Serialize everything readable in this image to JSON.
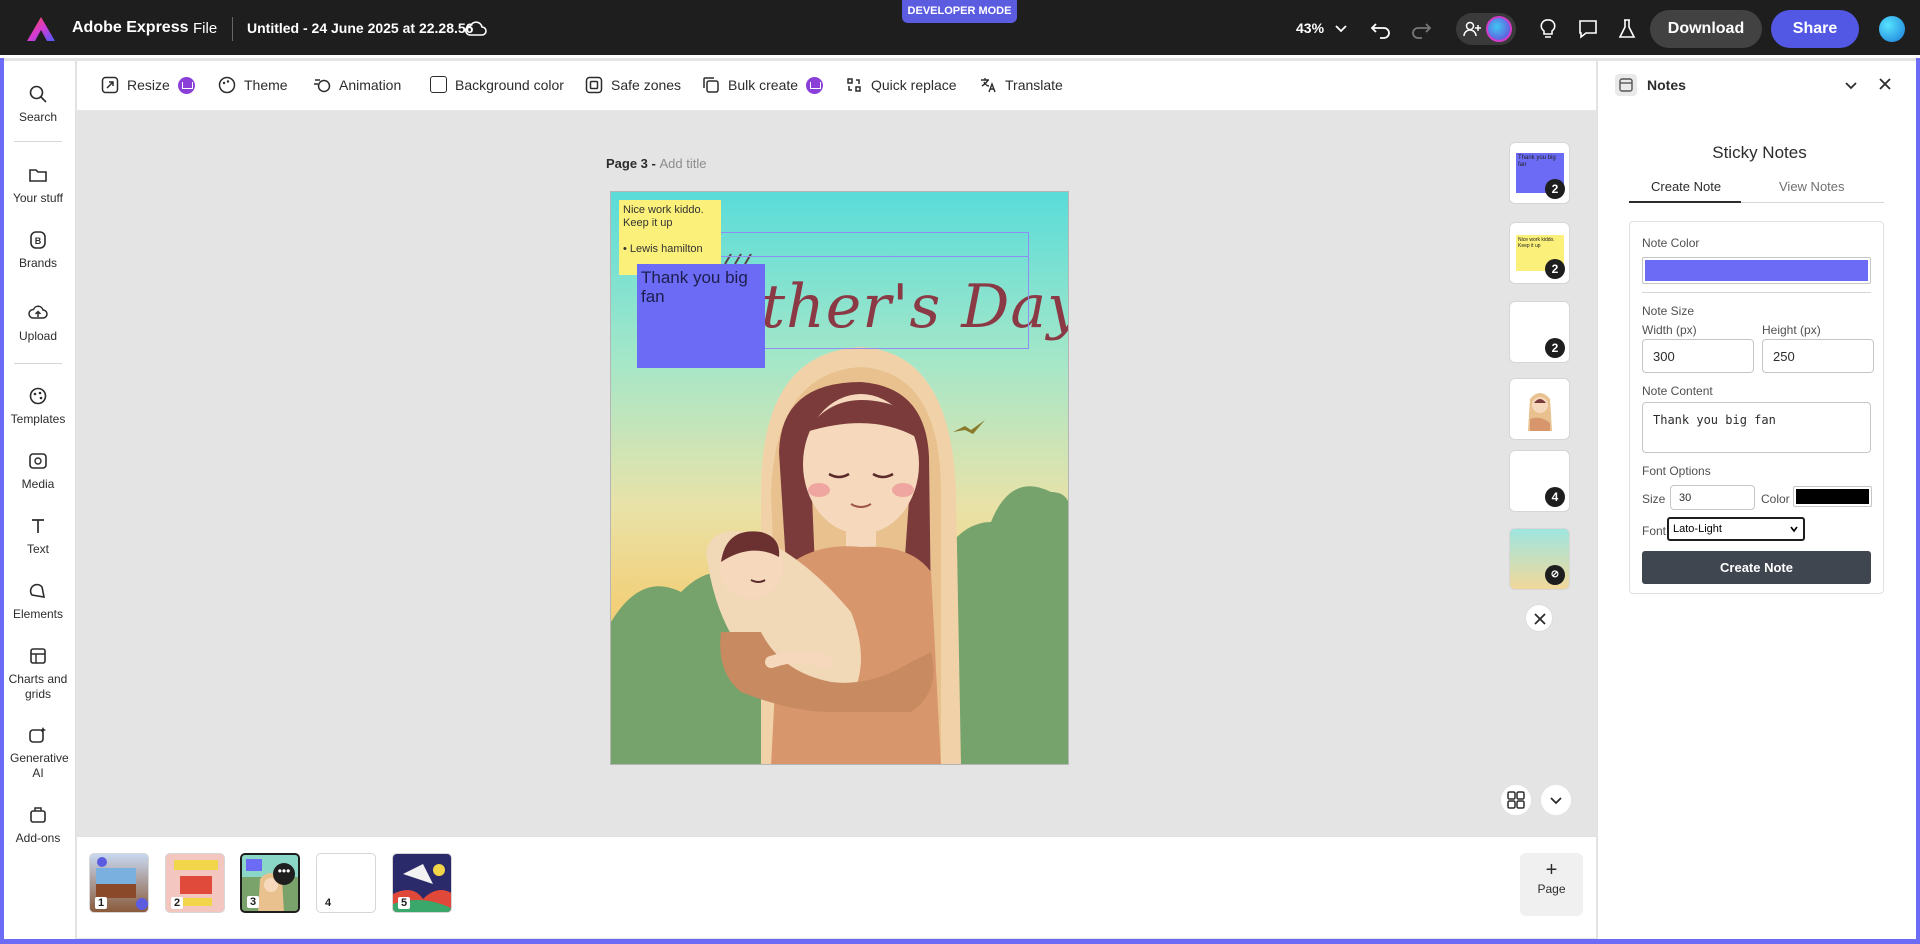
{
  "topbar": {
    "app_name": "Adobe Express",
    "file_menu": "File",
    "document_title": "Untitled - 24 June 2025 at 22.28.56",
    "dev_mode": "DEVELOPER MODE",
    "zoom": "43%",
    "download": "Download",
    "share": "Share"
  },
  "left_rail": {
    "items": [
      {
        "label": "Search",
        "icon": "search-icon"
      },
      {
        "label": "Your stuff",
        "icon": "folder-icon"
      },
      {
        "label": "Brands",
        "icon": "brand-icon"
      },
      {
        "label": "Upload",
        "icon": "upload-icon"
      },
      {
        "label": "Templates",
        "icon": "templates-icon"
      },
      {
        "label": "Media",
        "icon": "media-icon"
      },
      {
        "label": "Text",
        "icon": "text-icon"
      },
      {
        "label": "Elements",
        "icon": "elements-icon"
      },
      {
        "label": "Charts and grids",
        "icon": "charts-icon"
      },
      {
        "label": "Generative AI",
        "icon": "generative-ai-icon"
      },
      {
        "label": "Add-ons",
        "icon": "addons-icon"
      }
    ]
  },
  "toolbar": {
    "resize": "Resize",
    "theme": "Theme",
    "animation": "Animation",
    "background_color": "Background color",
    "safe_zones": "Safe zones",
    "bulk_create": "Bulk create",
    "quick_replace": "Quick replace",
    "translate": "Translate"
  },
  "canvas": {
    "page_label": "Page 3 - ",
    "add_title": "Add title",
    "artwork_title": "ther's Day",
    "yellow_note_line1": "Nice work kiddo.",
    "yellow_note_line2": "Keep it up",
    "yellow_note_line3": "• Lewis hamilton",
    "blue_note": "Thank you big fan"
  },
  "side_thumbs": {
    "badges": [
      "2",
      "2",
      "2",
      "",
      "4",
      ""
    ],
    "thumb1_text": "Thank you big fan",
    "thumb2_text": "Nice work kiddo. Keep it up"
  },
  "bottom_strip": {
    "pages": [
      "1",
      "2",
      "3",
      "4",
      "5"
    ],
    "add_page": "Page"
  },
  "notes_panel": {
    "header": "Notes",
    "title": "Sticky Notes",
    "tab_create": "Create Note",
    "tab_view": "View Notes",
    "note_color_label": "Note Color",
    "note_color": "#6b6bf5",
    "note_size_label": "Note Size",
    "width_label": "Width (px)",
    "width_value": "300",
    "height_label": "Height (px)",
    "height_value": "250",
    "content_label": "Note Content",
    "content_value": "Thank you big fan",
    "font_options_label": "Font Options",
    "size_label": "Size",
    "size_value": "30",
    "color_label": "Color",
    "font_color": "#000000",
    "font_label": "Font",
    "font_value": "Lato-Light",
    "create_button": "Create Note"
  }
}
